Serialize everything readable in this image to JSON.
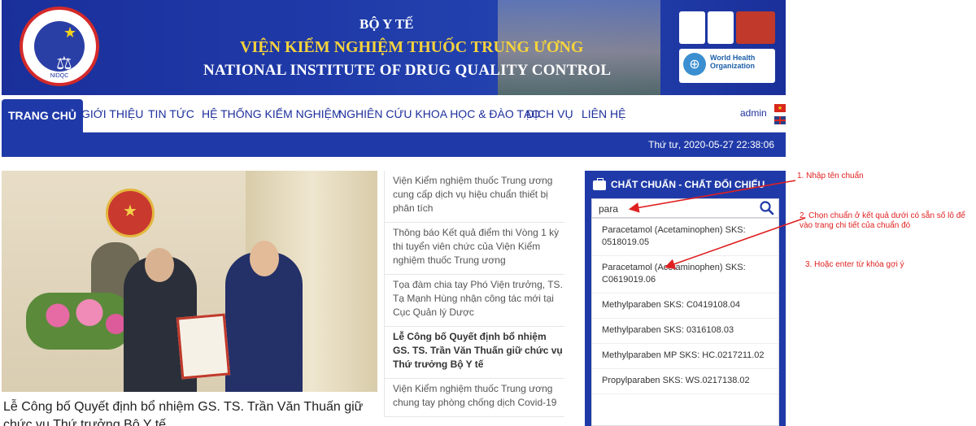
{
  "header": {
    "ministry": "BỘ Y TẾ",
    "institute_vn": "VIỆN KIỂM NGHIỆM THUỐC TRUNG ƯƠNG",
    "institute_en": "NATIONAL INSTITUTE OF DRUG QUALITY CONTROL",
    "logo_abbr": "NIDQC",
    "who_line1": "World Health",
    "who_line2": "Organization"
  },
  "nav": {
    "items": [
      "TRANG CHỦ",
      "GIỚI THIỆU",
      "TIN TỨC",
      "HỆ THỐNG KIỂM NGHIỆM",
      "NGHIÊN CỨU KHOA HỌC & ĐÀO TẠO",
      "DỊCH VỤ",
      "LIÊN HỆ"
    ],
    "active_index": 0,
    "user": "admin",
    "datetime": "Thứ tư, 2020-05-27 22:38:06"
  },
  "featured": {
    "title": "Lễ Công bố Quyết định bổ nhiệm GS. TS. Trần Văn Thuấn giữ chức vụ Thứ trưởng Bộ Y tế"
  },
  "news": [
    {
      "text": "Viện Kiểm nghiệm thuốc Trung ương cung cấp dịch vụ hiệu chuẩn thiết bị phân tích",
      "bold": false
    },
    {
      "text": "Thông báo Kết quả điểm thi Vòng 1 kỳ thi tuyển viên chức của Viện Kiểm nghiệm thuốc Trung ương",
      "bold": false
    },
    {
      "text": "Tọa đàm chia tay Phó Viện trưởng, TS. Tạ Mạnh Hùng nhận công tác mới tại Cục Quản lý Dược",
      "bold": false
    },
    {
      "text": "Lễ Công bố Quyết định bổ nhiệm GS. TS. Trần Văn Thuấn giữ chức vụ Thứ trưởng Bộ Y tế",
      "bold": true
    },
    {
      "text": "Viện Kiểm nghiệm thuốc Trung ương chung tay phòng chống dịch Covid-19",
      "bold": false
    }
  ],
  "widget": {
    "title": "CHẤT CHUẨN - CHẤT ĐỐI CHIẾU",
    "search_value": "para",
    "results": [
      "Paracetamol (Acetaminophen) SKS: 0518019.05",
      "Paracetamol (Acetaminophen) SKS: C0619019.06",
      "Methylparaben SKS: C0419108.04",
      "Methylparaben SKS: 0316108.03",
      "Methylparaben MP SKS: HC.0217211.02",
      "Propylparaben SKS: WS.0217138.02"
    ]
  },
  "annotations": {
    "step1": "1. Nhập tên chuẩn",
    "step2": "2. Chọn chuẩn ở kết quả dưới có sẵn số lô để vào trang chi tiết của chuẩn đó",
    "step3": "3. Hoặc enter từ khóa gợi ý"
  },
  "colors": {
    "brand_blue": "#1f3aa8",
    "gold": "#f5d33c",
    "annotation_red": "#e02020"
  }
}
